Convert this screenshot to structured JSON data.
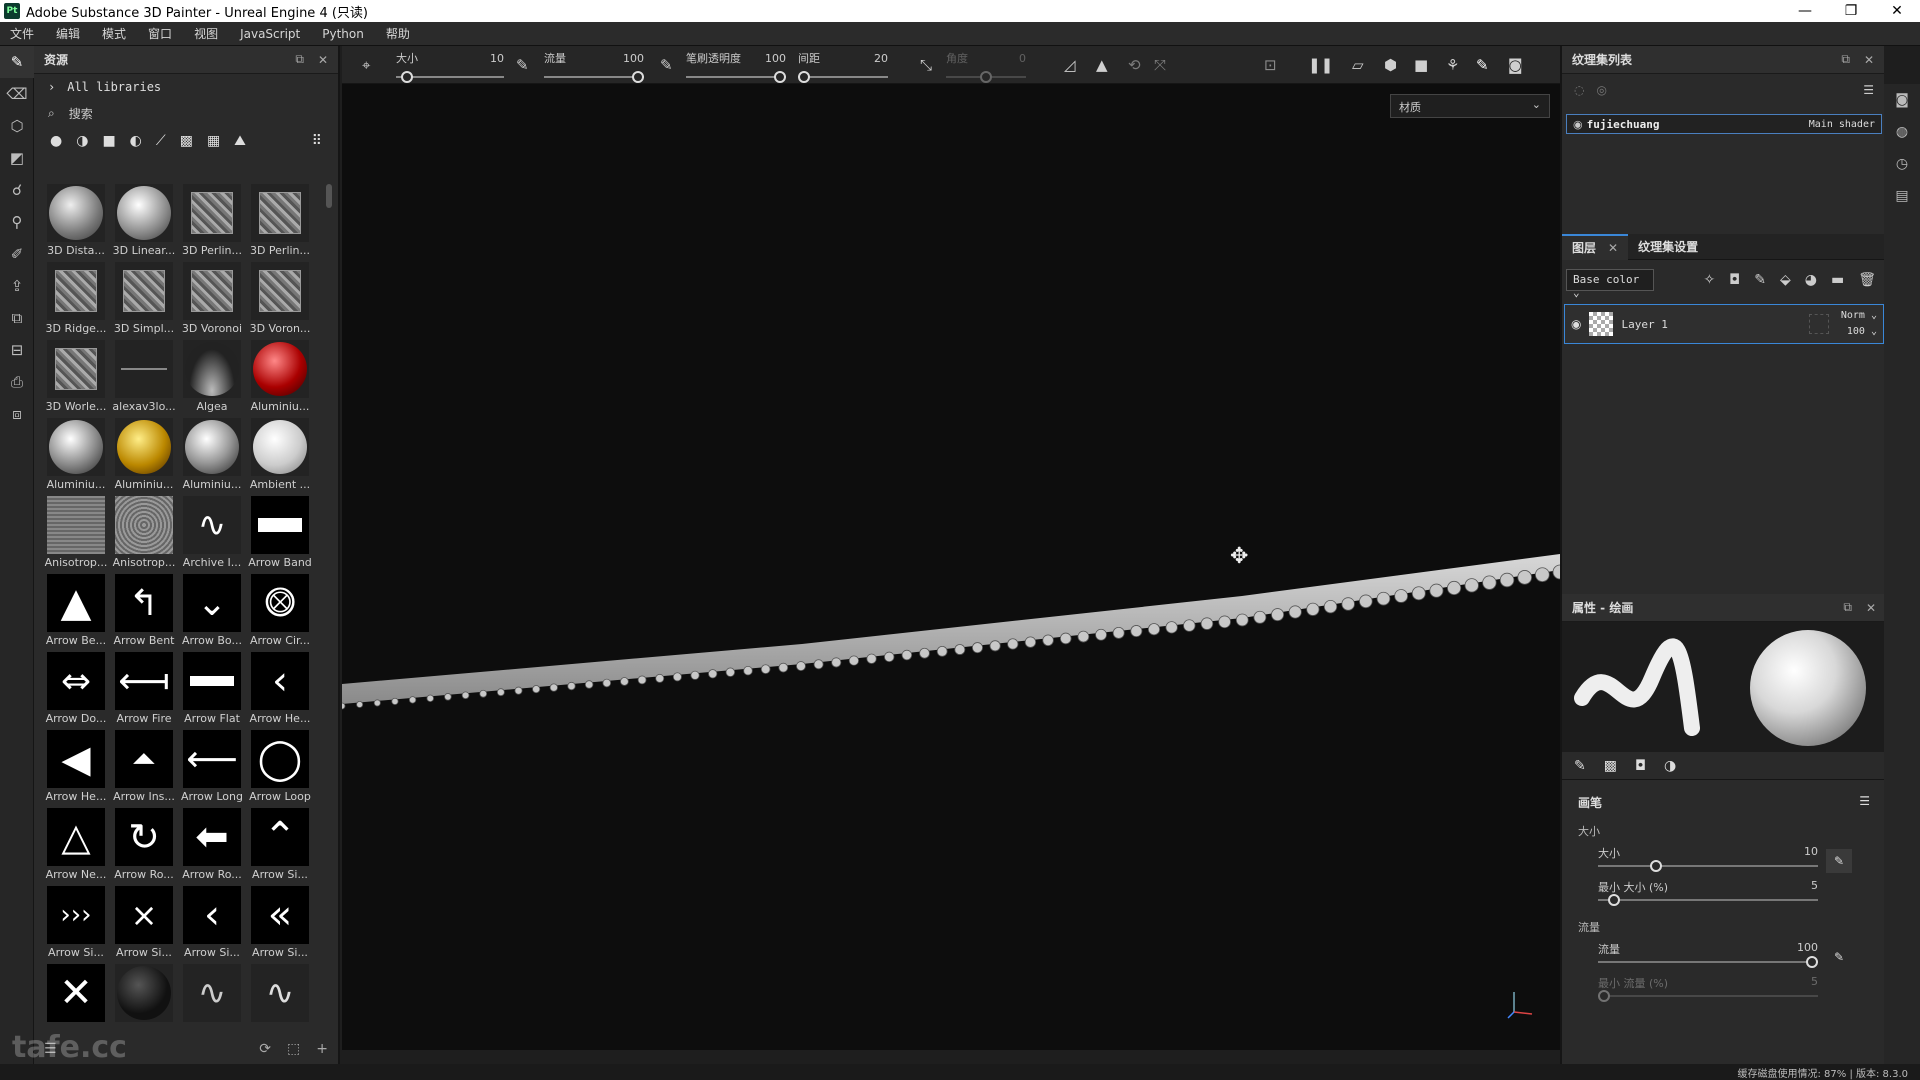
{
  "window": {
    "title": "Adobe Substance 3D Painter - Unreal Engine 4 (只读)",
    "logo": "Pt",
    "controls": [
      "—",
      "❐",
      "✕"
    ]
  },
  "menu": [
    "文件",
    "编辑",
    "模式",
    "窗口",
    "视图",
    "JavaScript",
    "Python",
    "帮助"
  ],
  "shelf": {
    "title": "资源",
    "libraries": "All libraries",
    "search_placeholder": "搜索",
    "assets": [
      {
        "label": "3D Dista..."
      },
      {
        "label": "3D Linear..."
      },
      {
        "label": "3D Perlin..."
      },
      {
        "label": "3D Perlin..."
      },
      {
        "label": "3D Ridge..."
      },
      {
        "label": "3D Simpl..."
      },
      {
        "label": "3D Voronoi"
      },
      {
        "label": "3D Voron..."
      },
      {
        "label": "3D Worle..."
      },
      {
        "label": "alexav3lo..."
      },
      {
        "label": "Algea"
      },
      {
        "label": "Aluminiu..."
      },
      {
        "label": "Aluminiu..."
      },
      {
        "label": "Aluminiu..."
      },
      {
        "label": "Aluminiu..."
      },
      {
        "label": "Ambient ..."
      },
      {
        "label": "Anisotrop..."
      },
      {
        "label": "Anisotrop..."
      },
      {
        "label": "Archive I..."
      },
      {
        "label": "Arrow Band"
      },
      {
        "label": "Arrow Be..."
      },
      {
        "label": "Arrow Bent"
      },
      {
        "label": "Arrow Bo..."
      },
      {
        "label": "Arrow Cir..."
      },
      {
        "label": "Arrow Do..."
      },
      {
        "label": "Arrow Fire"
      },
      {
        "label": "Arrow Flat"
      },
      {
        "label": "Arrow He..."
      },
      {
        "label": "Arrow He..."
      },
      {
        "label": "Arrow Ins..."
      },
      {
        "label": "Arrow Long"
      },
      {
        "label": "Arrow Loop"
      },
      {
        "label": "Arrow Ne..."
      },
      {
        "label": "Arrow Ro..."
      },
      {
        "label": "Arrow Ro..."
      },
      {
        "label": "Arrow Si..."
      },
      {
        "label": "Arrow Si..."
      },
      {
        "label": "Arrow Si..."
      },
      {
        "label": "Arrow Si..."
      },
      {
        "label": "Arrow Si..."
      },
      {
        "label": ""
      },
      {
        "label": ""
      },
      {
        "label": ""
      },
      {
        "label": ""
      }
    ]
  },
  "toolbar": {
    "size_label": "大小",
    "size_value": "10",
    "size_fraction": 0.05,
    "flow_label": "流量",
    "flow_value": "100",
    "flow_fraction": 1.0,
    "opacity_label": "笔刷透明度",
    "opacity_value": "100",
    "opacity_fraction": 1.0,
    "spacing_label": "间距",
    "spacing_value": "20",
    "spacing_fraction": 0.0,
    "angle_label": "角度",
    "angle_value": "0"
  },
  "viewport": {
    "material_mode": "材质"
  },
  "texture_set_list": {
    "title": "纹理集列表",
    "set_name": "fujiechuang",
    "shader": "Main shader"
  },
  "layers": {
    "tab_layers": "图层",
    "tab_settings": "纹理集设置",
    "channel": "Base color",
    "layer_name": "Layer 1",
    "blend_mode": "Norm",
    "opacity": "100"
  },
  "properties": {
    "title": "属性 - 绘画",
    "brush_section": "画笔",
    "size_group": "大小",
    "size_label": "大小",
    "size_value": "10",
    "size_fraction": 0.25,
    "min_size_label": "最小 大小 (%)",
    "min_size_value": "5",
    "min_size_fraction": 0.05,
    "flow_group": "流量",
    "flow_label": "流量",
    "flow_value": "100",
    "flow_fraction": 1.0,
    "min_flow_label": "最小 流量 (%)",
    "min_flow_value": "5"
  },
  "status": {
    "text": "缓存磁盘使用情况:   87%  |  版本:  8.3.0"
  },
  "watermark": "tafe.cc"
}
